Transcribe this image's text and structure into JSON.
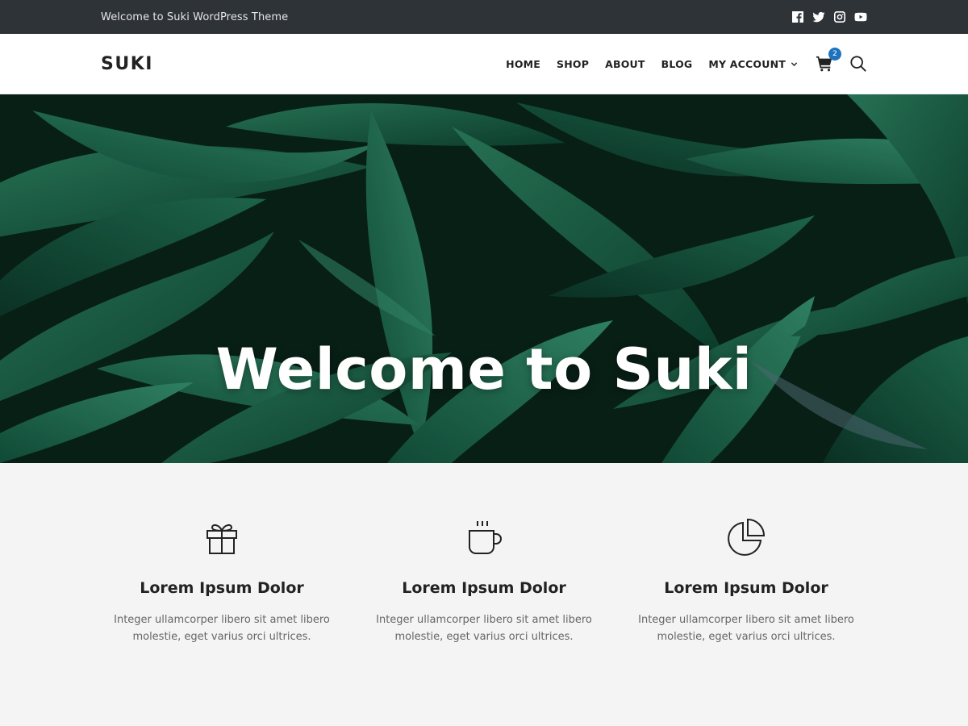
{
  "topbar": {
    "text": "Welcome to Suki WordPress Theme",
    "social": [
      "facebook-icon",
      "twitter-icon",
      "instagram-icon",
      "youtube-icon"
    ]
  },
  "header": {
    "logo": "SUKI",
    "nav": [
      {
        "label": "HOME"
      },
      {
        "label": "SHOP"
      },
      {
        "label": "ABOUT"
      },
      {
        "label": "BLOG"
      },
      {
        "label": "MY ACCOUNT"
      }
    ],
    "cart_count": "2"
  },
  "hero": {
    "title": "Welcome to Suki"
  },
  "features": [
    {
      "icon": "gift-icon",
      "title": "Lorem Ipsum Dolor",
      "description": "Integer ullamcorper libero sit amet libero molestie, eget varius orci ultrices."
    },
    {
      "icon": "coffee-cup-icon",
      "title": "Lorem Ipsum Dolor",
      "description": "Integer ullamcorper libero sit amet libero molestie, eget varius orci ultrices."
    },
    {
      "icon": "pie-chart-icon",
      "title": "Lorem Ipsum Dolor",
      "description": "Integer ullamcorper libero sit amet libero molestie, eget varius orci ultrices."
    }
  ],
  "colors": {
    "topbar_bg": "#2e3338",
    "accent": "#1e73be",
    "hero_green": "#1f6b50",
    "section_bg": "#f4f4f4"
  }
}
